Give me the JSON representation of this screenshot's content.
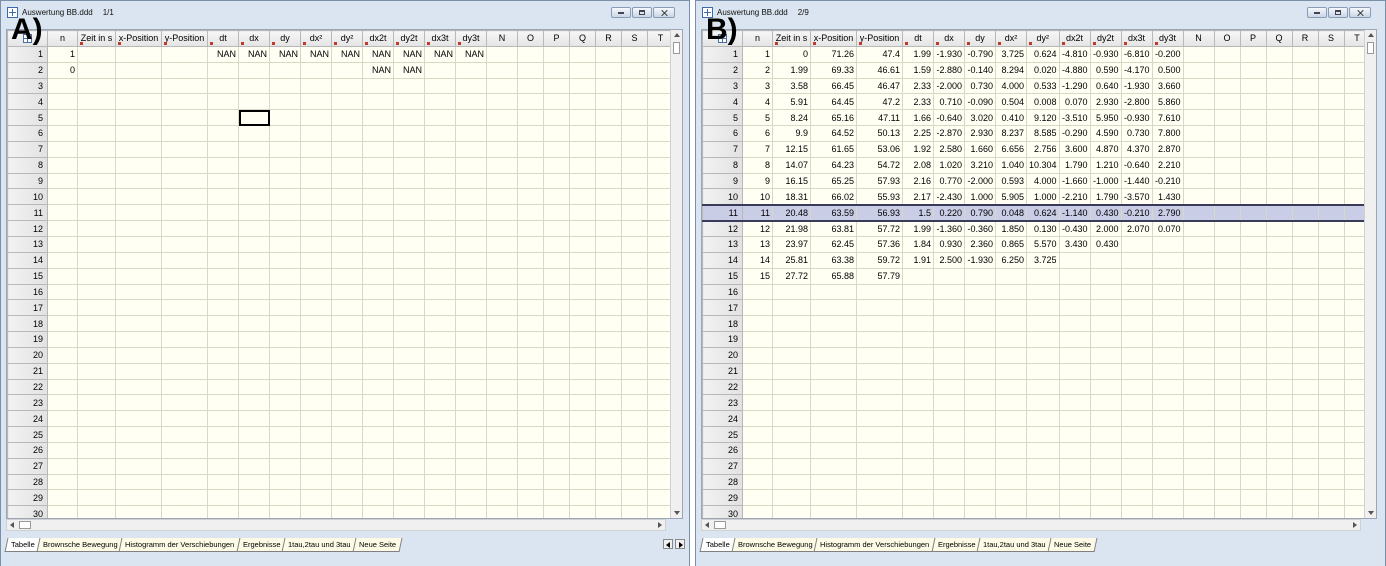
{
  "panels": [
    {
      "label": "A)",
      "window_title": "Auswertung BB.ddd",
      "page_indicator": "1/1",
      "columns": [
        "n",
        "Zeit in s",
        "x-Position",
        "y-Position",
        "dt",
        "dx",
        "dy",
        "dx²",
        "dy²",
        "dx2t",
        "dy2t",
        "dx3t",
        "dy3t",
        "N",
        "O",
        "P",
        "Q",
        "R",
        "S",
        "T"
      ],
      "rows": [
        [
          "1",
          "",
          "",
          "",
          "NAN",
          "NAN",
          "NAN",
          "NAN",
          "NAN",
          "NAN",
          "NAN",
          "NAN",
          "NAN",
          "",
          "",
          "",
          "",
          "",
          "",
          ""
        ],
        [
          "0",
          "",
          "",
          "",
          "",
          "",
          "",
          "",
          "",
          "NAN",
          "NAN",
          "",
          "",
          "",
          "",
          "",
          "",
          "",
          "",
          ""
        ]
      ],
      "row_count": 30,
      "tabs": [
        "Tabelle",
        "Brownsche Bewegung",
        "Histogramm der Verschiebungen",
        "Ergebnisse",
        "1tau,2tau und 3tau",
        "Neue Seite"
      ],
      "active_tab": "Tabelle"
    },
    {
      "label": "B)",
      "window_title": "Auswertung BB.ddd",
      "page_indicator": "2/9",
      "columns": [
        "n",
        "Zeit in s",
        "x-Position",
        "y-Position",
        "dt",
        "dx",
        "dy",
        "dx²",
        "dy²",
        "dx2t",
        "dy2t",
        "dx3t",
        "dy3t",
        "N",
        "O",
        "P",
        "Q",
        "R",
        "S",
        "T"
      ],
      "rows": [
        [
          "1",
          "0",
          "71.26",
          "47.4",
          "1.99",
          "-1.930",
          "-0.790",
          "3.725",
          "0.624",
          "-4.810",
          "-0.930",
          "-6.810",
          "-0.200"
        ],
        [
          "2",
          "1.99",
          "69.33",
          "46.61",
          "1.59",
          "-2.880",
          "-0.140",
          "8.294",
          "0.020",
          "-4.880",
          "0.590",
          "-4.170",
          "0.500"
        ],
        [
          "3",
          "3.58",
          "66.45",
          "46.47",
          "2.33",
          "-2.000",
          "0.730",
          "4.000",
          "0.533",
          "-1.290",
          "0.640",
          "-1.930",
          "3.660"
        ],
        [
          "4",
          "5.91",
          "64.45",
          "47.2",
          "2.33",
          "0.710",
          "-0.090",
          "0.504",
          "0.008",
          "0.070",
          "2.930",
          "-2.800",
          "5.860"
        ],
        [
          "5",
          "8.24",
          "65.16",
          "47.11",
          "1.66",
          "-0.640",
          "3.020",
          "0.410",
          "9.120",
          "-3.510",
          "5.950",
          "-0.930",
          "7.610"
        ],
        [
          "6",
          "9.9",
          "64.52",
          "50.13",
          "2.25",
          "-2.870",
          "2.930",
          "8.237",
          "8.585",
          "-0.290",
          "4.590",
          "0.730",
          "7.800"
        ],
        [
          "7",
          "12.15",
          "61.65",
          "53.06",
          "1.92",
          "2.580",
          "1.660",
          "6.656",
          "2.756",
          "3.600",
          "4.870",
          "4.370",
          "2.870"
        ],
        [
          "8",
          "14.07",
          "64.23",
          "54.72",
          "2.08",
          "1.020",
          "3.210",
          "1.040",
          "10.304",
          "1.790",
          "1.210",
          "-0.640",
          "2.210"
        ],
        [
          "9",
          "16.15",
          "65.25",
          "57.93",
          "2.16",
          "0.770",
          "-2.000",
          "0.593",
          "4.000",
          "-1.660",
          "-1.000",
          "-1.440",
          "-0.210"
        ],
        [
          "10",
          "18.31",
          "66.02",
          "55.93",
          "2.17",
          "-2.430",
          "1.000",
          "5.905",
          "1.000",
          "-2.210",
          "1.790",
          "-3.570",
          "1.430"
        ],
        [
          "11",
          "20.48",
          "63.59",
          "56.93",
          "1.5",
          "0.220",
          "0.790",
          "0.048",
          "0.624",
          "-1.140",
          "0.430",
          "-0.210",
          "2.790"
        ],
        [
          "12",
          "21.98",
          "63.81",
          "57.72",
          "1.99",
          "-1.360",
          "-0.360",
          "1.850",
          "0.130",
          "-0.430",
          "2.000",
          "2.070",
          "0.070"
        ],
        [
          "13",
          "23.97",
          "62.45",
          "57.36",
          "1.84",
          "0.930",
          "2.360",
          "0.865",
          "5.570",
          "3.430",
          "0.430",
          "",
          ""
        ],
        [
          "14",
          "25.81",
          "63.38",
          "59.72",
          "1.91",
          "2.500",
          "-1.930",
          "6.250",
          "3.725",
          "",
          "",
          "",
          ""
        ],
        [
          "15",
          "27.72",
          "65.88",
          "57.79",
          "",
          "",
          "",
          "",
          "",
          "",
          "",
          "",
          ""
        ]
      ],
      "selected_row": 11,
      "row_count": 30,
      "tabs": [
        "Tabelle",
        "Brownsche Bewegung",
        "Histogramm der Verschiebungen",
        "Ergebnisse",
        "1tau,2tau und 3tau",
        "Neue Seite"
      ],
      "active_tab": "Tabelle"
    }
  ],
  "colors": {
    "selected_row": "#c9cde6",
    "grid_background": "#fffff4",
    "window_frame": "#dbe5f1"
  }
}
